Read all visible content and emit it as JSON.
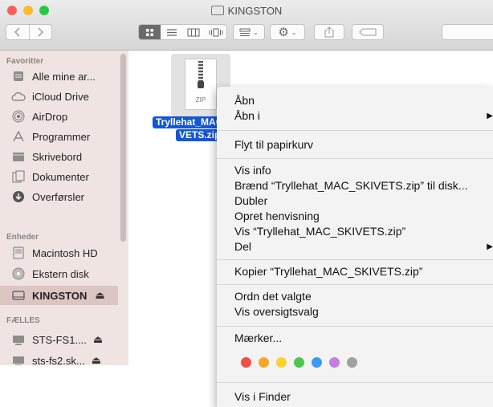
{
  "window": {
    "title": "KINGSTON",
    "traffic_lights": {
      "close": "#fc5f57",
      "minimize": "#fdbc2e",
      "zoom": "#28c840"
    }
  },
  "toolbar": {
    "back_icon": "chevron-left-icon",
    "forward_icon": "chevron-right-icon",
    "view_icons": [
      "grid-view-icon",
      "list-view-icon",
      "column-view-icon",
      "coverflow-view-icon"
    ],
    "arrange_icon": "arrange-icon",
    "action_icon": "gear-icon",
    "share_icon": "share-icon",
    "tag_icon": "tag-icon"
  },
  "sidebar": {
    "sections": [
      {
        "title": "Favoritter",
        "items": [
          {
            "label": "Alle mine ar...",
            "icon": "all-files-icon"
          },
          {
            "label": "iCloud Drive",
            "icon": "cloud-icon"
          },
          {
            "label": "AirDrop",
            "icon": "airdrop-icon"
          },
          {
            "label": "Programmer",
            "icon": "applications-icon"
          },
          {
            "label": "Skrivebord",
            "icon": "desktop-icon"
          },
          {
            "label": "Dokumenter",
            "icon": "documents-icon"
          },
          {
            "label": "Overførsler",
            "icon": "downloads-icon"
          }
        ]
      },
      {
        "title": "Enheder",
        "items": [
          {
            "label": "Macintosh HD",
            "icon": "hard-drive-icon"
          },
          {
            "label": "Ekstern disk",
            "icon": "external-disk-icon"
          },
          {
            "label": "KINGSTON",
            "icon": "usb-drive-icon",
            "eject": "⏏",
            "selected": true
          }
        ]
      },
      {
        "title": "FÆLLES",
        "items": [
          {
            "label": "STS-FS1....",
            "icon": "server-icon",
            "eject": "⏏"
          },
          {
            "label": "sts-fs2.sk...",
            "icon": "server-icon",
            "eject": "⏏"
          }
        ]
      }
    ]
  },
  "file": {
    "type_label": "ZIP",
    "name_line1": "Tryllehat_MAC",
    "name_line2": "VETS.zip"
  },
  "context_menu": {
    "groups": [
      [
        "Åbn",
        "Åbn i"
      ],
      [
        "Flyt til papirkurv"
      ],
      [
        "Vis info",
        "Brænd “Tryllehat_MAC_SKIVETS.zip” til disk...",
        "Dubler",
        "Opret henvisning",
        "Vis “Tryllehat_MAC_SKIVETS.zip”",
        "Del"
      ],
      [
        "Kopier “Tryllehat_MAC_SKIVETS.zip”"
      ],
      [
        "Ordn det valgte",
        "Vis oversigtsvalg"
      ],
      [
        "Mærker..."
      ],
      [
        "Vis i Finder"
      ]
    ],
    "submenu_arrow": "▶",
    "tag_colors": [
      "#f24e41",
      "#f6a623",
      "#f7d433",
      "#4fc84f",
      "#3b9af4",
      "#c67fe0",
      "#a0a0a0"
    ]
  }
}
